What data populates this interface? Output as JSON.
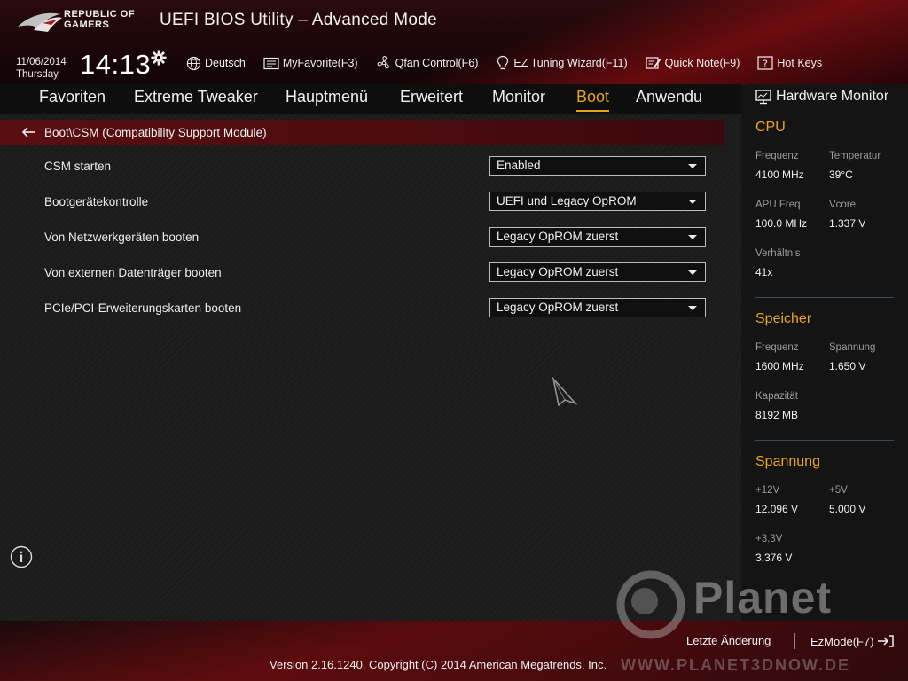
{
  "brand": {
    "line1": "REPUBLIC OF",
    "line2": "GAMERS"
  },
  "header": {
    "title": "UEFI BIOS Utility – Advanced Mode",
    "date": "11/06/2014",
    "weekday": "Thursday",
    "time": "14:13"
  },
  "toolbar": {
    "language": "Deutsch",
    "myfavorite": "MyFavorite(F3)",
    "qfan": "Qfan Control(F6)",
    "ez_tuning": "EZ Tuning Wizard(F11)",
    "quick_note": "Quick Note(F9)",
    "hot_keys": "Hot Keys"
  },
  "nav": {
    "tabs": [
      "Favoriten",
      "Extreme Tweaker",
      "Hauptmenü",
      "Erweitert",
      "Monitor",
      "Boot",
      "Anwendu"
    ],
    "active": "Boot"
  },
  "breadcrumb": "Boot\\CSM (Compatibility Support Module)",
  "settings": [
    {
      "label": "CSM starten",
      "value": "Enabled"
    },
    {
      "label": "Bootgerätekontrolle",
      "value": "UEFI und Legacy OpROM"
    },
    {
      "label": "Von Netzwerkgeräten booten",
      "value": "Legacy OpROM zuerst"
    },
    {
      "label": "Von externen Datenträger booten",
      "value": "Legacy OpROM zuerst"
    },
    {
      "label": "PCIe/PCI-Erweiterungskarten booten",
      "value": "Legacy OpROM zuerst"
    }
  ],
  "hardware_monitor": {
    "title": "Hardware Monitor",
    "cpu": {
      "heading": "CPU",
      "freq_label": "Frequenz",
      "freq_value": "4100 MHz",
      "temp_label": "Temperatur",
      "temp_value": "39°C",
      "apu_label": "APU Freq.",
      "apu_value": "100.0 MHz",
      "vcore_label": "Vcore",
      "vcore_value": "1.337 V",
      "ratio_label": "Verhältnis",
      "ratio_value": "41x"
    },
    "memory": {
      "heading": "Speicher",
      "freq_label": "Frequenz",
      "freq_value": "1600 MHz",
      "volt_label": "Spannung",
      "volt_value": "1.650 V",
      "cap_label": "Kapazität",
      "cap_value": "8192 MB"
    },
    "voltage": {
      "heading": "Spannung",
      "v12_label": "+12V",
      "v12_value": "12.096 V",
      "v5_label": "+5V",
      "v5_value": "5.000 V",
      "v33_label": "+3.3V",
      "v33_value": "3.376 V"
    }
  },
  "footer": {
    "last_change": "Letzte Änderung",
    "ezmode": "EzMode(F7)",
    "version": "Version 2.16.1240. Copyright (C) 2014 American Megatrends, Inc."
  },
  "watermark": {
    "name": "Planet",
    "url": "WWW.PLANET3DNOW.DE"
  },
  "colors": {
    "accent": "#e8a61e",
    "breadcrumb_bg": "#5a0e12",
    "brand_red": "#b4141a"
  }
}
